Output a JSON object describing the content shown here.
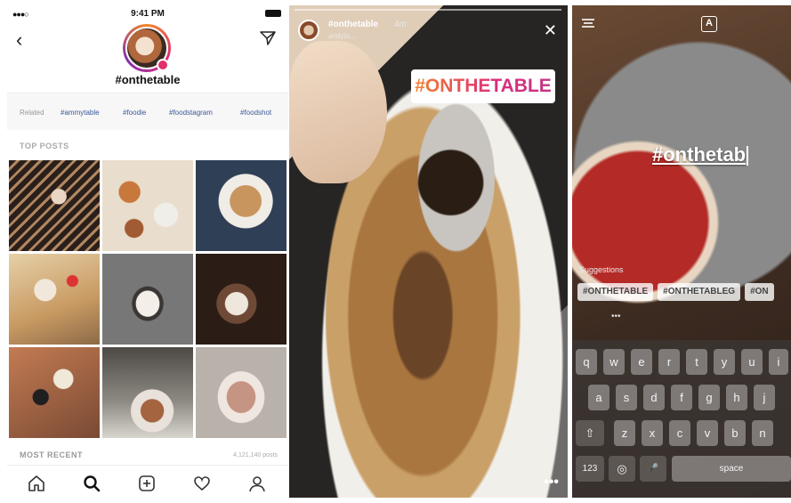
{
  "panel_hashtag": {
    "status_time": "9:41 PM",
    "title": "#onthetable",
    "tags_label": "Related",
    "tags": [
      "#ammytable",
      "#foodie",
      "#foodstagram",
      "#foodshot"
    ],
    "top_posts_label": "TOP POSTS",
    "most_recent_label": "MOST RECENT",
    "post_count": "4,121,140 posts"
  },
  "panel_story": {
    "username": "#onthetable",
    "time": "4m",
    "subtitle": "andyto...",
    "sticker_text": "#ONTHETABLE",
    "more": "•••"
  },
  "panel_keyboard": {
    "font_button": "A",
    "typed_text": "#onthetab",
    "suggestions_label": "Suggestions",
    "suggestions": [
      "#ONTHETABLE",
      "#ONTHETABLEG",
      "#ON"
    ],
    "dots": "•••",
    "row1": [
      "q",
      "w",
      "e",
      "r",
      "t",
      "y",
      "u",
      "i"
    ],
    "row2": [
      "a",
      "s",
      "d",
      "f",
      "g",
      "h",
      "j"
    ],
    "row3": [
      "z",
      "x",
      "c",
      "v",
      "b",
      "n"
    ],
    "shift_glyph": "⇧",
    "num_key": "123",
    "globe_glyph": "◎",
    "mic_glyph": "🎤",
    "space_key": "space"
  }
}
